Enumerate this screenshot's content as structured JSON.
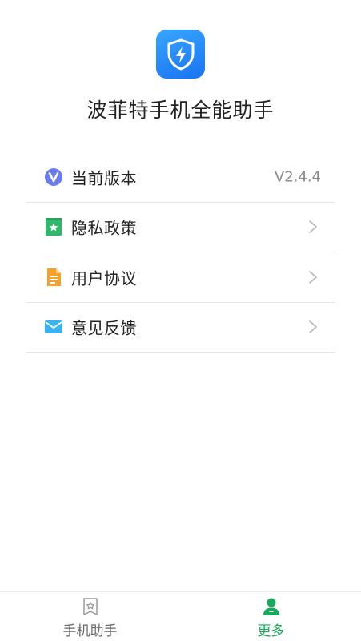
{
  "app": {
    "name": "波菲特手机全能助手"
  },
  "menu": {
    "items": [
      {
        "label": "当前版本",
        "value": "V2.4.4",
        "icon": "v-badge-icon",
        "icon_color": "#6b7cf0"
      },
      {
        "label": "隐私政策",
        "icon": "bookmark-icon",
        "icon_color": "#2db86a"
      },
      {
        "label": "用户协议",
        "icon": "document-icon",
        "icon_color": "#f7a12b"
      },
      {
        "label": "意见反馈",
        "icon": "mail-icon",
        "icon_color": "#3bb2f0"
      }
    ]
  },
  "tabbar": {
    "home": {
      "label": "手机助手",
      "icon": "bookmark-star-icon",
      "active": false
    },
    "more": {
      "label": "更多",
      "icon": "user-icon",
      "active": true
    }
  },
  "colors": {
    "accent": "#1aa85a",
    "logo_blue": "#1a73f0",
    "divider": "#e6e6e6"
  }
}
